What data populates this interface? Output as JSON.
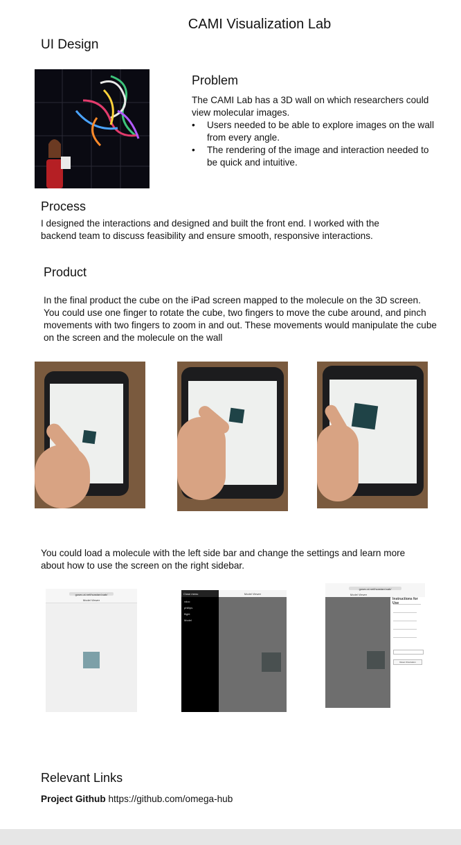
{
  "header": {
    "title": "CAMI Visualization Lab",
    "subtitle": "UI Design"
  },
  "problem": {
    "heading": "Problem",
    "intro": "The CAMI Lab has a 3D wall on which researchers could view molecular images.",
    "bullets": [
      "Users needed to be able to explore images on the wall from every angle.",
      "The rendering of the image and interaction needed to be quick and intuitive."
    ]
  },
  "process": {
    "heading": "Process",
    "text": "I designed the interactions and designed and built the front end. I worked with the backend team to discuss feasibility and ensure smooth, responsive interactions."
  },
  "product": {
    "heading": "Product",
    "text": "In the final product the cube on the iPad screen mapped to the molecule on the 3D screen. You could use one finger to rotate the cube, two fingers to move the cube around, and pinch movements with two fingers to zoom in and out. These movements would manipulate the cube on the screen and the molecule on the wall",
    "sidebar_text": "You could load a molecule with the left side bar and change the settings and learn more about how to use the screen on the right sidebar."
  },
  "screenshots": {
    "url": "gosec.ai.net/hcastard.sab/",
    "model_viewer": "Model Viewer",
    "close_menu": "Close menu",
    "menu_items": [
      "vdoc",
      "phillips",
      "flight",
      "Model"
    ],
    "instructions_title": "Instructions for Use",
    "reset_button": "Reset Orientation"
  },
  "links": {
    "heading": "Relevant Links",
    "label": "Project Github",
    "url": "https://github.com/omega-hub"
  }
}
